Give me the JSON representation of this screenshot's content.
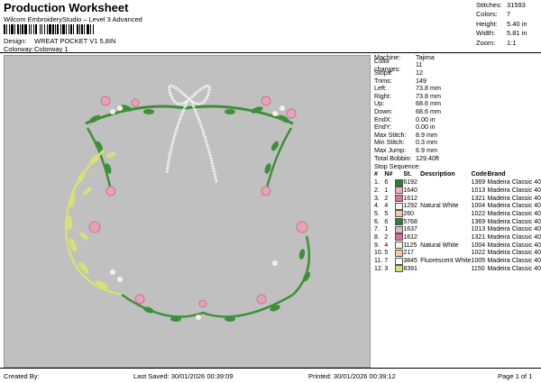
{
  "header": {
    "title": "Production Worksheet",
    "subtitle": "Wilcom EmbroideryStudio – Level 3 Advanced",
    "design_label": "Design:",
    "design_value": "WREAT POCKET V1 5,8IN",
    "colorway_label": "Colorway:",
    "colorway_value": "Colorway 1"
  },
  "stats": [
    {
      "label": "Stitches:",
      "value": "31593"
    },
    {
      "label": "Colors:",
      "value": "7"
    },
    {
      "label": "Height:",
      "value": "5.40 in"
    },
    {
      "label": "Width:",
      "value": "5.81 in"
    },
    {
      "label": "Zoom:",
      "value": "1:1"
    }
  ],
  "info": [
    {
      "label": "Machine:",
      "value": "Tajima"
    },
    {
      "label": "Color changes:",
      "value": "11"
    },
    {
      "label": "Stops:",
      "value": "12"
    },
    {
      "label": "Trims:",
      "value": "149"
    },
    {
      "label": "Left:",
      "value": "73.8 mm"
    },
    {
      "label": "Right:",
      "value": "73.8 mm"
    },
    {
      "label": "Up:",
      "value": "68.6 mm"
    },
    {
      "label": "Down:",
      "value": "68.6 mm"
    },
    {
      "label": "EndX:",
      "value": "0.00 in"
    },
    {
      "label": "EndY:",
      "value": "0.00 in"
    },
    {
      "label": "Max Stitch:",
      "value": "8.9 mm"
    },
    {
      "label": "Min Stitch:",
      "value": "0.3 mm"
    },
    {
      "label": "Max Jump:",
      "value": "6.9 mm"
    },
    {
      "label": "Total Bobbin:",
      "value": "129.40ft"
    }
  ],
  "sequence": {
    "title": "Stop Sequence:",
    "headers": {
      "num": "#",
      "n": "N#",
      "st": "St.",
      "desc": "Description",
      "code": "Code",
      "brand": "Brand"
    },
    "rows": [
      {
        "num": "1.",
        "n": "6",
        "color": "#2e7d32",
        "st": "6192",
        "desc": "",
        "code": "1369",
        "brand": "Madeira Classic 40"
      },
      {
        "num": "2.",
        "n": "1",
        "color": "#e8b4c0",
        "st": "1640",
        "desc": "",
        "code": "1013",
        "brand": "Madeira Classic 40"
      },
      {
        "num": "3.",
        "n": "2",
        "color": "#d9739a",
        "st": "1612",
        "desc": "",
        "code": "1321",
        "brand": "Madeira Classic 40"
      },
      {
        "num": "4.",
        "n": "4",
        "color": "#f4f1e4",
        "st": "1292",
        "desc": "Natural White",
        "code": "1004",
        "brand": "Madeira Classic 40"
      },
      {
        "num": "5.",
        "n": "5",
        "color": "#f3c9a4",
        "st": "260",
        "desc": "",
        "code": "1022",
        "brand": "Madeira Classic 40"
      },
      {
        "num": "6.",
        "n": "6",
        "color": "#2e7d32",
        "st": "5768",
        "desc": "",
        "code": "1369",
        "brand": "Madeira Classic 40"
      },
      {
        "num": "7.",
        "n": "1",
        "color": "#e8b4c0",
        "st": "1637",
        "desc": "",
        "code": "1013",
        "brand": "Madeira Classic 40"
      },
      {
        "num": "8.",
        "n": "2",
        "color": "#d9739a",
        "st": "1612",
        "desc": "",
        "code": "1321",
        "brand": "Madeira Classic 40"
      },
      {
        "num": "9.",
        "n": "4",
        "color": "#f4f1e4",
        "st": "1125",
        "desc": "Natural White",
        "code": "1004",
        "brand": "Madeira Classic 40"
      },
      {
        "num": "10.",
        "n": "5",
        "color": "#f3c9a4",
        "st": "217",
        "desc": "",
        "code": "1022",
        "brand": "Madeira Classic 40"
      },
      {
        "num": "11.",
        "n": "7",
        "color": "#ffffff",
        "st": "3845",
        "desc": "Fluorescent White",
        "code": "1005",
        "brand": "Madeira Classic 40"
      },
      {
        "num": "12.",
        "n": "3",
        "color": "#d6e07a",
        "st": "8391",
        "desc": "",
        "code": "1150",
        "brand": "Madeira Classic 40"
      }
    ]
  },
  "footer": {
    "created": "Created By:",
    "saved": "Last Saved: 30/01/2026 00:39:09",
    "printed": "Printed: 30/01/2026 00:39:12",
    "page": "Page 1 of 1"
  },
  "colors": {
    "preview_bg": "#c0c0c0",
    "leaf": "#3f8f3a",
    "rose": "#e7a3b6",
    "bow": "#f4f6f6",
    "wheat": "#d8df78"
  }
}
